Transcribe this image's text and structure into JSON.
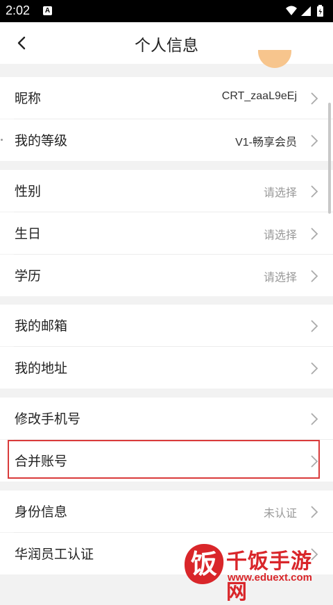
{
  "status_bar": {
    "time": "2:02",
    "notification_icon": "A"
  },
  "header": {
    "title": "个人信息"
  },
  "groups": [
    {
      "rows": [
        {
          "label": "昵称",
          "value": "CRT_zaaL9eEj",
          "grey": false
        },
        {
          "label": "我的等级",
          "value": "V1-畅享会员",
          "grey": false
        }
      ]
    },
    {
      "rows": [
        {
          "label": "性别",
          "value": "请选择",
          "grey": true
        },
        {
          "label": "生日",
          "value": "请选择",
          "grey": true
        },
        {
          "label": "学历",
          "value": "请选择",
          "grey": true
        }
      ]
    },
    {
      "rows": [
        {
          "label": "我的邮箱",
          "value": "",
          "grey": false
        },
        {
          "label": "我的地址",
          "value": "",
          "grey": false
        }
      ]
    },
    {
      "rows": [
        {
          "label": "修改手机号",
          "value": "",
          "grey": false
        },
        {
          "label": "合并账号",
          "value": "",
          "grey": false
        }
      ]
    },
    {
      "rows": [
        {
          "label": "身份信息",
          "value": "未认证",
          "grey": true
        },
        {
          "label": "华润员工认证",
          "value": "",
          "grey": false
        }
      ]
    }
  ],
  "watermark": {
    "logo_char": "饭",
    "title": "千饭手游网",
    "url": "www.eduext.com"
  },
  "colors": {
    "highlight": "#d93a3a",
    "watermark": "#d9262a",
    "avatar": "#f7c58d"
  }
}
